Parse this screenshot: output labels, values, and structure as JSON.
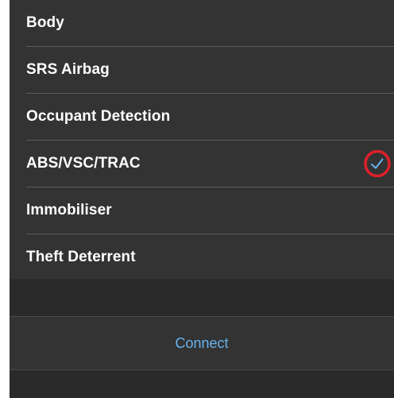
{
  "list": {
    "items": [
      {
        "label": "Body",
        "selected": false
      },
      {
        "label": "SRS Airbag",
        "selected": false
      },
      {
        "label": "Occupant Detection",
        "selected": false
      },
      {
        "label": "ABS/VSC/TRAC",
        "selected": true
      },
      {
        "label": "Immobiliser",
        "selected": false
      },
      {
        "label": "Theft Deterrent",
        "selected": false
      }
    ],
    "check_icon": "checkmark-icon"
  },
  "connect": {
    "label": "Connect"
  },
  "colors": {
    "background": "#333333",
    "text": "#ffffff",
    "accent": "#67b3ee",
    "annotation": "#e0202a"
  }
}
